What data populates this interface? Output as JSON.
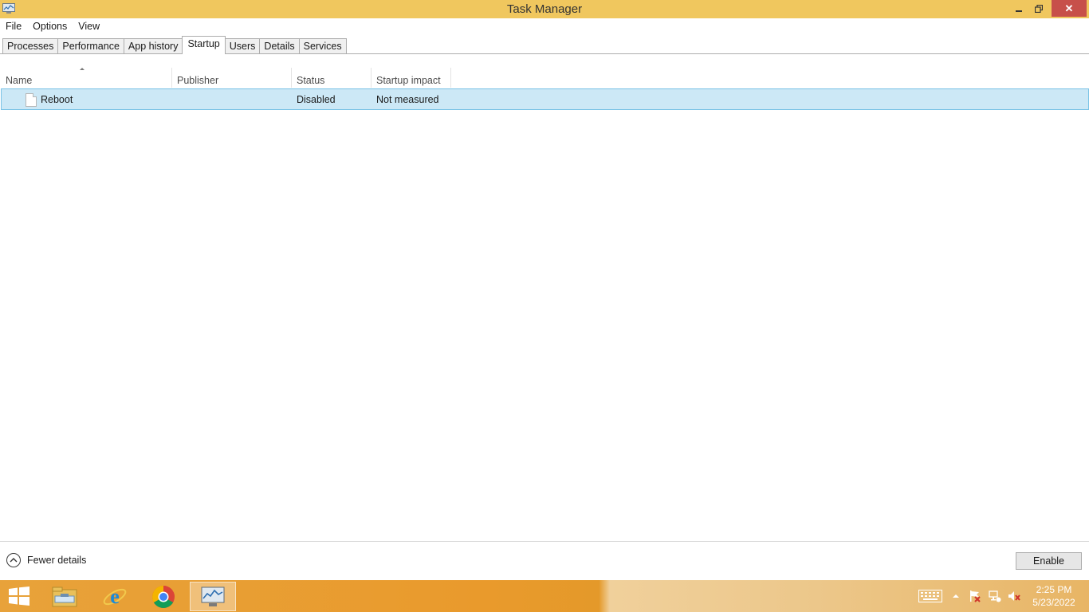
{
  "window": {
    "title": "Task Manager",
    "minimize_glyph": "–",
    "maximize_glyph": "❐",
    "close_glyph": "✕"
  },
  "menu": {
    "file": "File",
    "options": "Options",
    "view": "View"
  },
  "tabs": {
    "processes": "Processes",
    "performance": "Performance",
    "app_history": "App history",
    "startup": "Startup",
    "users": "Users",
    "details": "Details",
    "services": "Services"
  },
  "columns": {
    "name": "Name",
    "publisher": "Publisher",
    "status": "Status",
    "startup_impact": "Startup impact"
  },
  "rows": [
    {
      "name": "Reboot",
      "publisher": "",
      "status": "Disabled",
      "startup_impact": "Not measured"
    }
  ],
  "footer": {
    "fewer_details": "Fewer details",
    "enable_button": "Enable"
  },
  "taskbar": {
    "time": "2:25 PM",
    "date": "5/23/2022",
    "items": [
      "start-button",
      "file-explorer",
      "internet-explorer",
      "google-chrome",
      "task-manager"
    ]
  },
  "colors": {
    "titlebar": "#f0c75e",
    "selected_row": "#cce8f6",
    "close_button": "#c7504a"
  }
}
